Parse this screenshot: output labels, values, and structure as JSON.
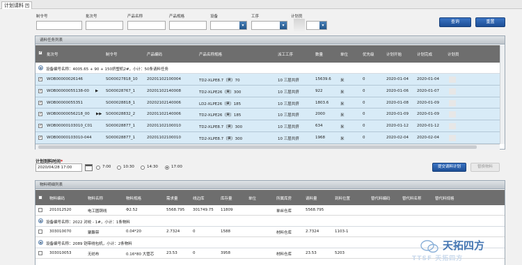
{
  "tab": {
    "title": "计划请料",
    "close": "×"
  },
  "filters": {
    "labels": [
      "制令号",
      "批次号",
      "产品名称",
      "产品规格",
      "设备",
      "工序",
      "计划员"
    ],
    "dropdown_glyph": "▾",
    "query_label": "查询",
    "reset_label": "重置"
  },
  "task_list": {
    "title": "请料任务列表",
    "columns": [
      "批次号",
      "制令号",
      "产品编码",
      "产品名称规格",
      "派工工序",
      "数量",
      "单位",
      "优先级",
      "计划开始",
      "计划完成",
      "计划员"
    ],
    "group_text": "设备编号名称：4005.65 + 90 + 150挤塑机2#，小计：50条请料任务",
    "rows": [
      {
        "checked": true,
        "batch": "WOB00000026146",
        "order": "SO00027818_10",
        "product_code": "20201102100004",
        "product_spec": "TD2-XLPE8.7（黑）70",
        "process": "10 三层共挤",
        "qty": "15639.6",
        "unit": "米",
        "priority": "0",
        "start": "2020-01-04",
        "finish": "2020-01-04",
        "marker": ""
      },
      {
        "checked": true,
        "batch": "WOB00000055138-00",
        "order": "SO00028767_1",
        "product_code": "20201102140008",
        "product_spec": "TD2-XLPE26（黑）300",
        "process": "10 三层共挤",
        "qty": "922",
        "unit": "米",
        "priority": "0",
        "start": "2020-01-06",
        "finish": "2020-01-07",
        "marker": "▶"
      },
      {
        "checked": true,
        "batch": "WOB00000055351",
        "order": "SO00028818_1",
        "product_code": "20202102140006",
        "product_spec": "LD2-XLPE26（黑）185",
        "process": "10 三层共挤",
        "qty": "1803.6",
        "unit": "米",
        "priority": "0",
        "start": "2020-01-08",
        "finish": "2020-01-09",
        "marker": ""
      },
      {
        "checked": true,
        "batch": "WOB00000056218_00",
        "order": "SO00028832_2",
        "product_code": "20201102140006",
        "product_spec": "TD2-XLPE26（黑）185",
        "process": "10 三层共挤",
        "qty": "2000",
        "unit": "米",
        "priority": "0",
        "start": "2020-01-09",
        "finish": "2020-01-09",
        "marker": "▶▶"
      },
      {
        "checked": true,
        "batch": "WOB00000103010_C01",
        "order": "SO00028877_1",
        "product_code": "20201102100010",
        "product_spec": "TD2-XLPE8.7（黑）300",
        "process": "10 三层共挤",
        "qty": "634",
        "unit": "米",
        "priority": "0",
        "start": "2020-01-12",
        "finish": "2020-01-12",
        "marker": ""
      },
      {
        "checked": true,
        "batch": "WOB00000103010-044",
        "order": "SO00028877_1",
        "product_code": "20201102100010",
        "product_spec": "TD2-XLPE8.7（黑）300",
        "process": "10 三层共挤",
        "qty": "1968",
        "unit": "米",
        "priority": "0",
        "start": "2020-02-04",
        "finish": "2020-02-04",
        "marker": ""
      }
    ]
  },
  "plan": {
    "label": "计划到料时间",
    "required": "*",
    "date_value": "2020/04/28 17:00",
    "times": [
      {
        "label": "7:00",
        "selected": false
      },
      {
        "label": "10:30",
        "selected": false
      },
      {
        "label": "14:30",
        "selected": false
      },
      {
        "label": "17:00",
        "selected": true
      }
    ],
    "submit_label": "提交请料计划",
    "cancel_label": "替换物料"
  },
  "material_list": {
    "title": "物料明细列表",
    "columns": [
      "物料编码",
      "物料名称",
      "物料规格",
      "需求量",
      "线边库",
      "库存量",
      "单位",
      "所属库房",
      "请料量",
      "到料位置",
      "替代料编码",
      "替代料名称",
      "替代料规格"
    ],
    "rows": [
      {
        "type": "row",
        "code": "201012520",
        "name": "电工圆铜线",
        "spec": "Φ2.52",
        "demand": "5568.795",
        "line_stock": "301749.75",
        "stock": "11809",
        "unit": "",
        "warehouse": "单丝仓库",
        "request": "5568.795",
        "position": ""
      },
      {
        "type": "group",
        "text": "设备编号名称：2022 对绞 - 1#，小计：1条物料"
      },
      {
        "type": "row",
        "code": "303010070",
        "name": "聚酯带",
        "spec": "0.04*20",
        "demand": "2.7324",
        "line_stock": "0",
        "stock": "1588",
        "unit": "",
        "warehouse": "材料仓库",
        "request": "2.7324",
        "position": "1103-1"
      },
      {
        "type": "group",
        "text": "设备编号名称：2089 铠带绕包机，小计：2条物料"
      },
      {
        "type": "row",
        "code": "303010053",
        "name": "无纺布",
        "spec": "0.16*80 大管芯",
        "demand": "23.53",
        "line_stock": "0",
        "stock": "3958",
        "unit": "",
        "warehouse": "材料仓库",
        "request": "23.53",
        "position": "5203"
      }
    ]
  },
  "watermark": {
    "text": "天拓四方",
    "sub": "TTSF 天拓四方"
  }
}
